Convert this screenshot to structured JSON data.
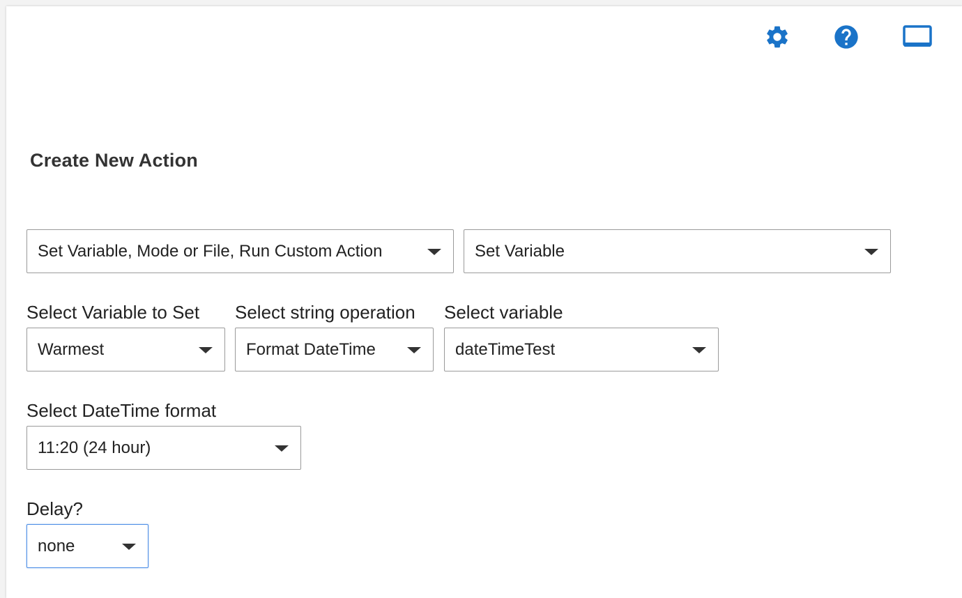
{
  "toolbar": {
    "settings_icon": "gear-icon",
    "help_icon": "question-circle-icon",
    "display_icon": "monitor-icon",
    "accent_color": "#1a73c8"
  },
  "page": {
    "title": "Create New Action"
  },
  "action_category": {
    "value": "Set Variable, Mode or File, Run Custom Action"
  },
  "action_type": {
    "value": "Set Variable"
  },
  "variable_to_set": {
    "label": "Select Variable to Set",
    "value": "Warmest"
  },
  "string_operation": {
    "label": "Select string operation",
    "value": "Format DateTime"
  },
  "source_variable": {
    "label": "Select variable",
    "value": "dateTimeTest"
  },
  "datetime_format": {
    "label": "Select DateTime format",
    "value": "11:20 (24 hour)"
  },
  "delay": {
    "label": "Delay?",
    "value": "none"
  }
}
